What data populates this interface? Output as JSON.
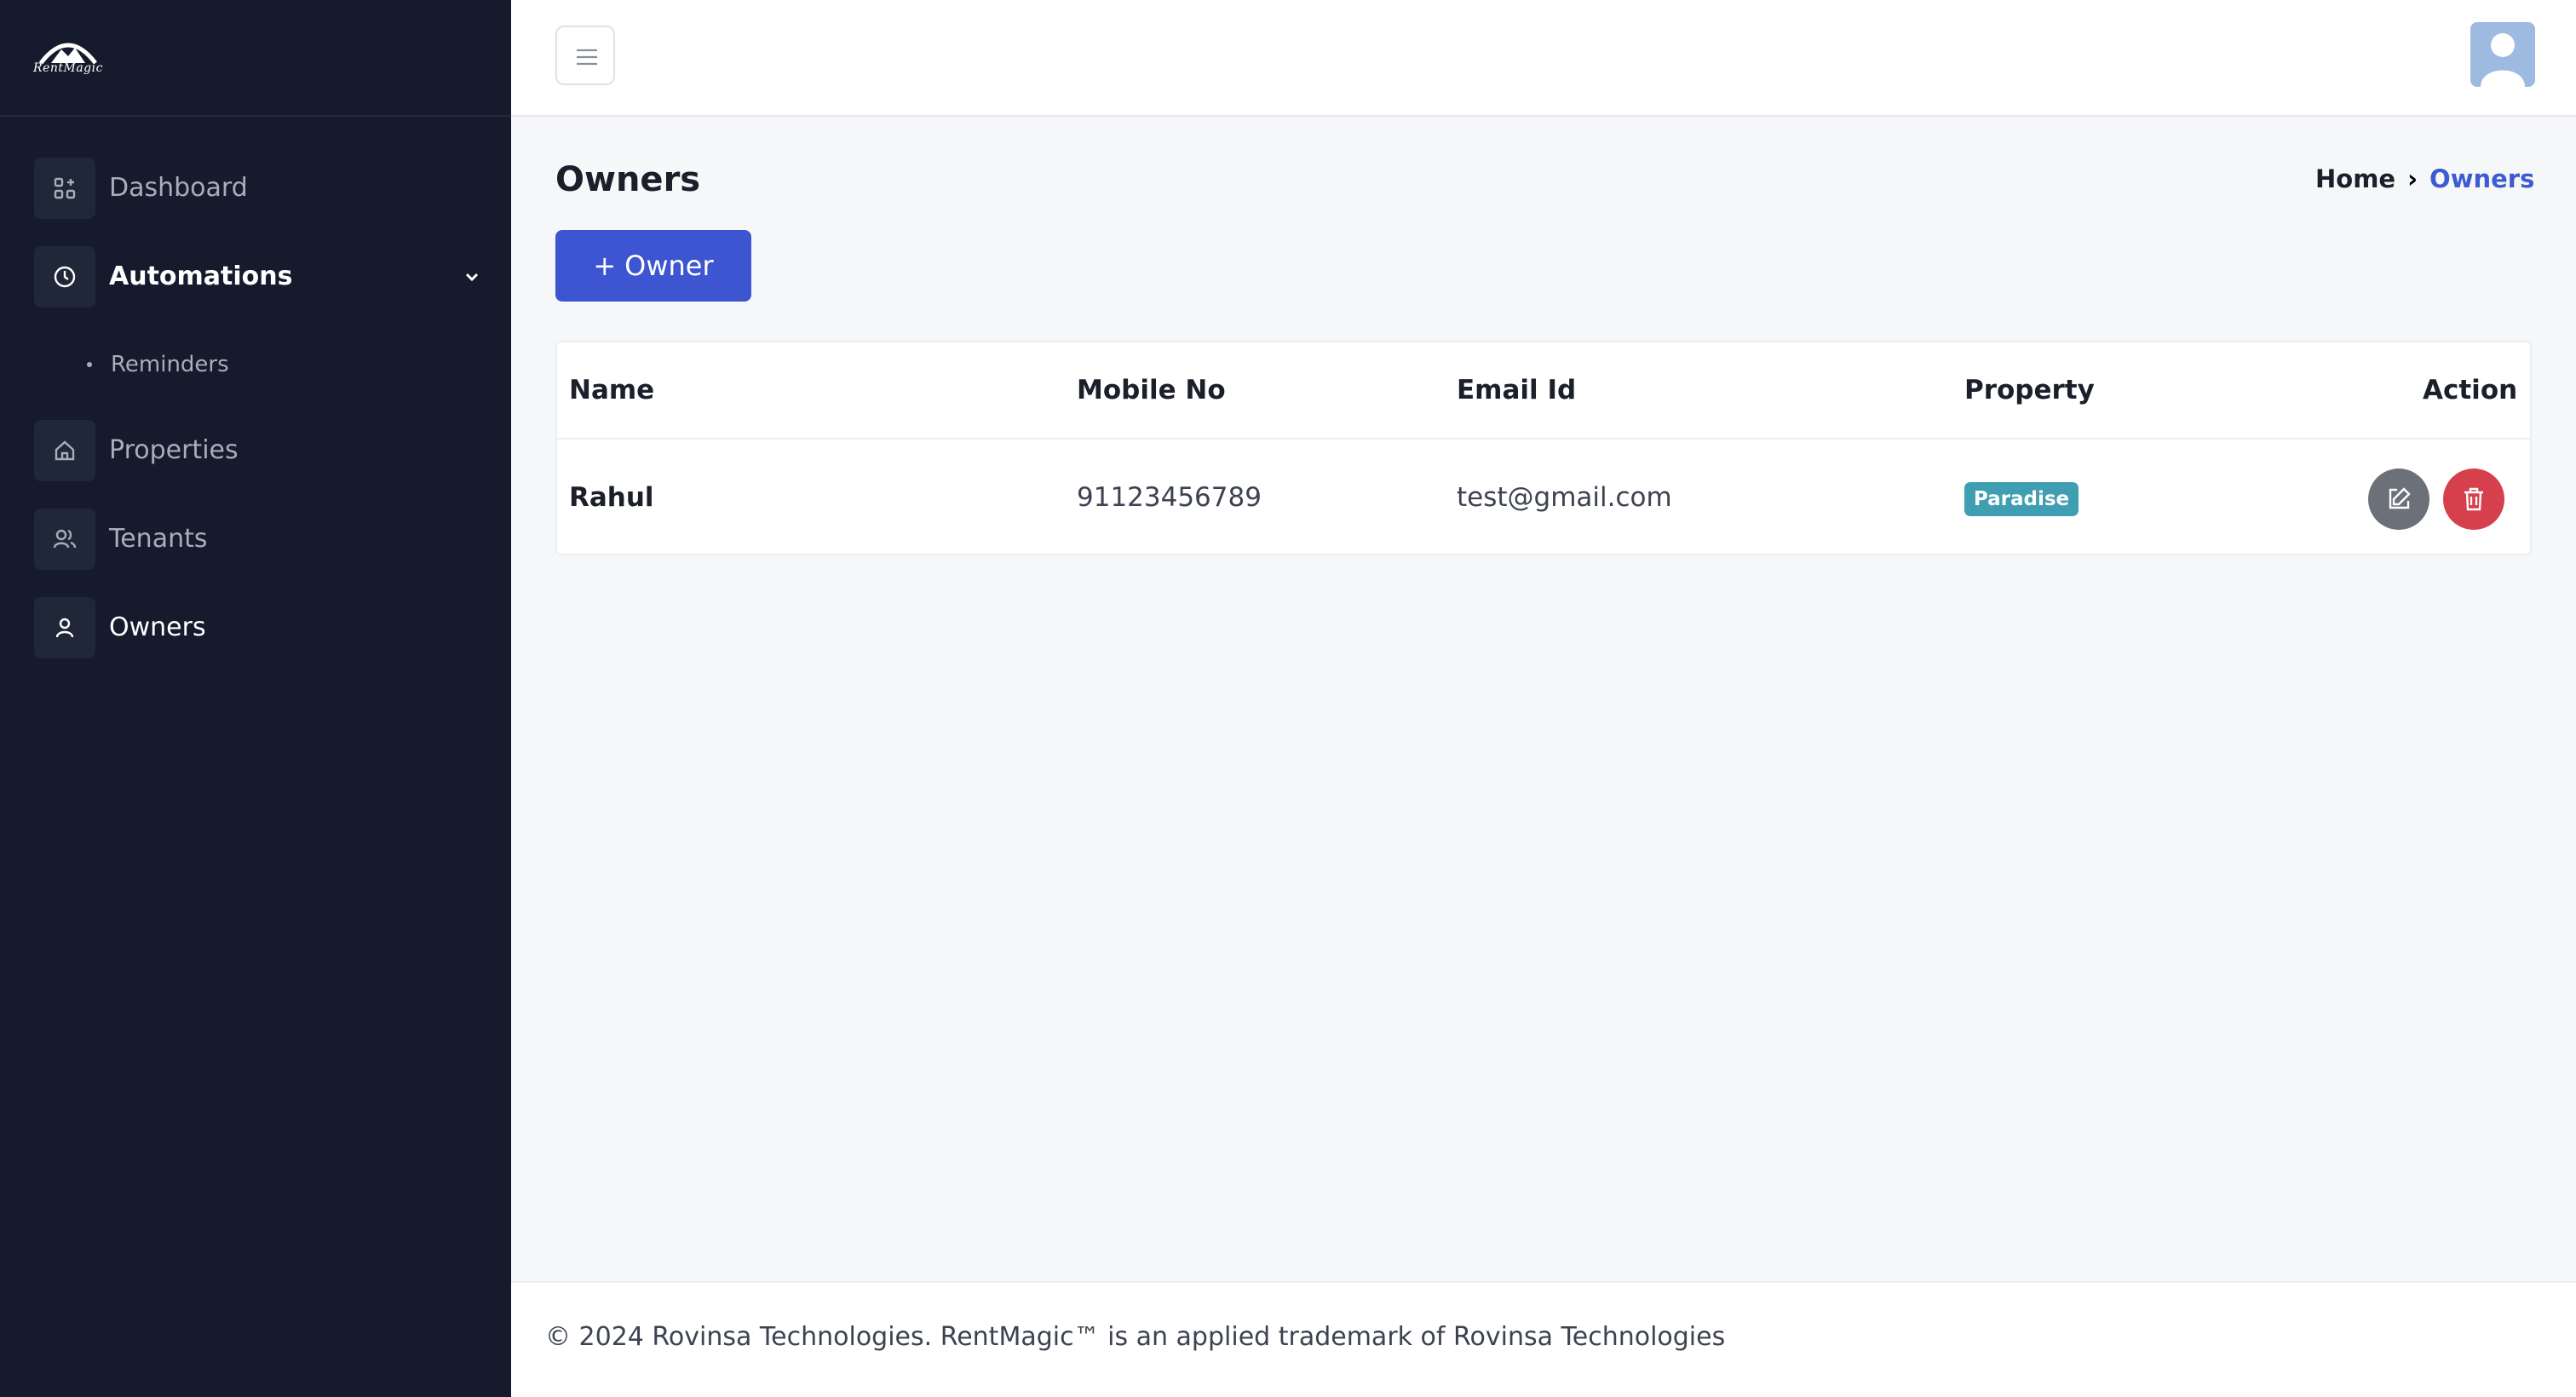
{
  "brand": {
    "logo_text": "RentMagic"
  },
  "sidebar": {
    "items": [
      {
        "label": "Dashboard",
        "icon": "dashboard-icon"
      },
      {
        "label": "Automations",
        "icon": "clock-icon",
        "expanded": true,
        "children": [
          {
            "label": "Reminders"
          }
        ]
      },
      {
        "label": "Properties",
        "icon": "home-icon"
      },
      {
        "label": "Tenants",
        "icon": "users-icon"
      },
      {
        "label": "Owners",
        "icon": "user-icon",
        "active": true
      }
    ]
  },
  "header": {
    "menu_icon": "hamburger-icon",
    "avatar_icon": "avatar-icon"
  },
  "page": {
    "title": "Owners",
    "breadcrumb": {
      "home": "Home",
      "separator": "›",
      "current": "Owners"
    },
    "add_button": {
      "icon": "+",
      "label": "Owner"
    }
  },
  "table": {
    "columns": [
      "Name",
      "Mobile No",
      "Email Id",
      "Property",
      "Action"
    ],
    "rows": [
      {
        "name": "Rahul",
        "mobile": "91123456789",
        "email": "test@gmail.com",
        "property": "Paradise"
      }
    ]
  },
  "footer": {
    "text": "© 2024 Rovinsa Technologies. RentMagic™ is an applied trademark of Rovinsa Technologies"
  },
  "colors": {
    "sidebar_bg": "#151b2d",
    "primary": "#3d55d1",
    "badge": "#3f9eb1",
    "danger": "#d6404d",
    "secondary": "#6b7079"
  }
}
